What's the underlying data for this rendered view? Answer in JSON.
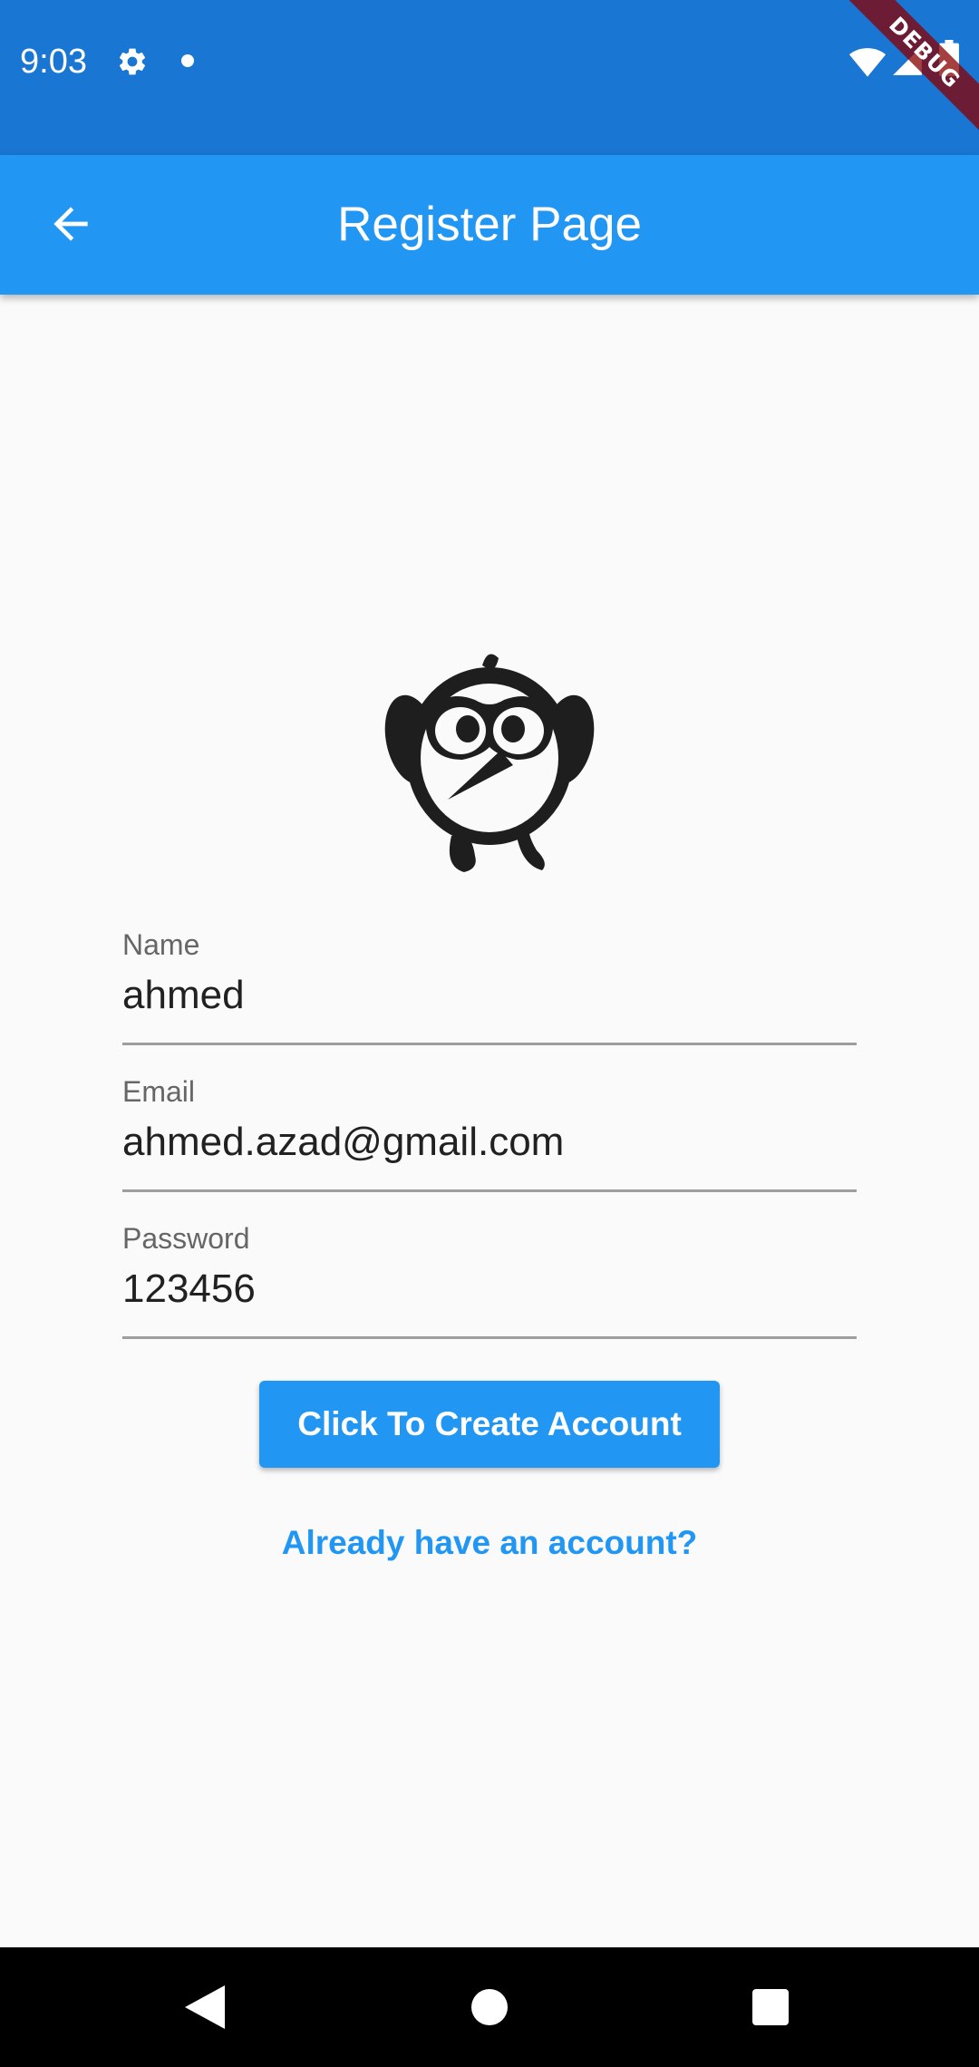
{
  "status_bar": {
    "time": "9:03",
    "icons": [
      "gear-icon",
      "notification-dot-icon",
      "wifi-icon",
      "cell-signal-icon",
      "battery-icon"
    ],
    "background_color": "#1976d2"
  },
  "debug_banner": {
    "label": "DEBUG"
  },
  "app_bar": {
    "title": "Register Page",
    "back_icon": "arrow-back-icon",
    "background_color": "#2196f3"
  },
  "logo": {
    "icon": "bird-mascot-icon"
  },
  "form": {
    "name": {
      "label": "Name",
      "value": "ahmed"
    },
    "email": {
      "label": "Email",
      "value": "ahmed.azad@gmail.com"
    },
    "password": {
      "label": "Password",
      "value": "123456"
    }
  },
  "actions": {
    "create_button_label": "Click To Create Account",
    "login_link_label": "Already have an account?",
    "accent_color": "#2196f3"
  },
  "nav_bar": {
    "icons": [
      "nav-back-icon",
      "nav-home-icon",
      "nav-recents-icon"
    ]
  }
}
